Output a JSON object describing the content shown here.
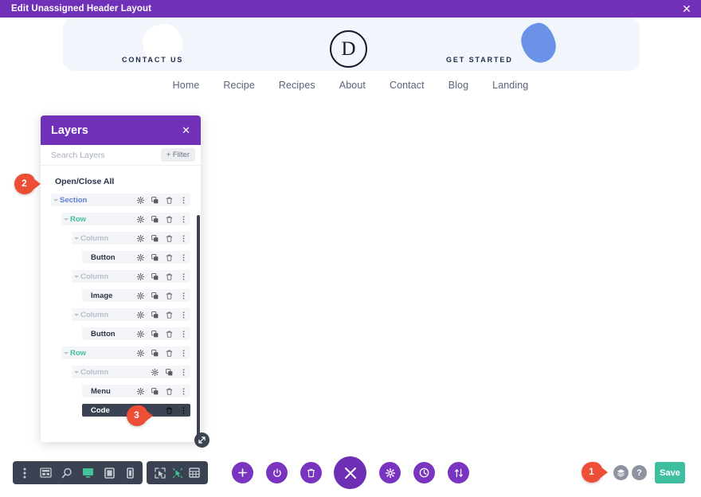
{
  "window": {
    "title": "Edit Unassigned Header Layout",
    "close_icon": "close-icon",
    "accent": "#7030b8"
  },
  "hero": {
    "contact_label": "CONTACT US",
    "started_label": "GET STARTED",
    "logo_letter": "D",
    "background": "#f2f5fc",
    "blob_blue": "#6a93e8"
  },
  "nav": {
    "items": [
      {
        "label": "Home"
      },
      {
        "label": "Recipe"
      },
      {
        "label": "Recipes"
      },
      {
        "label": "About"
      },
      {
        "label": "Contact"
      },
      {
        "label": "Blog"
      },
      {
        "label": "Landing"
      }
    ]
  },
  "layers_panel": {
    "title": "Layers",
    "close_icon": "close-icon",
    "search_placeholder": "Search Layers",
    "search_value": "",
    "filter_label": "+ Filter",
    "open_close_all": "Open/Close All",
    "rows": [
      {
        "label": "Section",
        "type": "section",
        "indent": 0,
        "caret": true,
        "icons": [
          "gear",
          "duplicate",
          "trash",
          "more"
        ],
        "active": false
      },
      {
        "label": "Row",
        "type": "row",
        "indent": 1,
        "caret": true,
        "icons": [
          "gear",
          "duplicate",
          "trash",
          "more"
        ],
        "active": false
      },
      {
        "label": "Column",
        "type": "column",
        "indent": 2,
        "caret": true,
        "icons": [
          "gear",
          "duplicate",
          "trash",
          "more"
        ],
        "active": false
      },
      {
        "label": "Button",
        "type": "module",
        "indent": 3,
        "caret": false,
        "icons": [
          "gear",
          "duplicate",
          "trash",
          "more"
        ],
        "active": false
      },
      {
        "label": "Column",
        "type": "column",
        "indent": 2,
        "caret": true,
        "icons": [
          "gear",
          "duplicate",
          "trash",
          "more"
        ],
        "active": false
      },
      {
        "label": "Image",
        "type": "module",
        "indent": 3,
        "caret": false,
        "icons": [
          "gear",
          "duplicate",
          "trash",
          "more"
        ],
        "active": false
      },
      {
        "label": "Column",
        "type": "column",
        "indent": 2,
        "caret": true,
        "icons": [
          "gear",
          "duplicate",
          "trash",
          "more"
        ],
        "active": false
      },
      {
        "label": "Button",
        "type": "module",
        "indent": 3,
        "caret": false,
        "icons": [
          "gear",
          "duplicate",
          "trash",
          "more"
        ],
        "active": false
      },
      {
        "label": "Row",
        "type": "row",
        "indent": 1,
        "caret": true,
        "icons": [
          "gear",
          "duplicate",
          "trash",
          "more"
        ],
        "active": false
      },
      {
        "label": "Column",
        "type": "column",
        "indent": 2,
        "caret": true,
        "icons": [
          "gear",
          "duplicate",
          "more"
        ],
        "active": false
      },
      {
        "label": "Menu",
        "type": "module",
        "indent": 3,
        "caret": false,
        "icons": [
          "gear",
          "duplicate",
          "trash",
          "more"
        ],
        "active": false
      },
      {
        "label": "Code",
        "type": "module",
        "indent": 3,
        "caret": false,
        "icons": [
          "trash",
          "more"
        ],
        "active": true
      }
    ],
    "colors": {
      "section": "#5b7fd4",
      "row": "#43bfa3",
      "column": "#b7bdc9",
      "module": "#2b3246",
      "active_row": "#3b4252"
    }
  },
  "markers": [
    {
      "id": "1",
      "label": "1"
    },
    {
      "id": "2",
      "label": "2"
    },
    {
      "id": "3",
      "label": "3"
    }
  ],
  "view_toolbar": {
    "icons": [
      {
        "name": "more-vertical-icon",
        "active": false
      },
      {
        "name": "wireframe-icon",
        "active": false
      },
      {
        "name": "zoom-icon",
        "active": false
      },
      {
        "name": "desktop-icon",
        "active": true
      },
      {
        "name": "tablet-icon",
        "active": false
      },
      {
        "name": "phone-icon",
        "active": false
      }
    ]
  },
  "mode_toolbar": {
    "icons": [
      {
        "name": "hover-mode-icon",
        "active": false
      },
      {
        "name": "click-mode-icon",
        "active": true
      },
      {
        "name": "grid-mode-icon",
        "active": false
      }
    ]
  },
  "action_buttons": [
    {
      "name": "add-button",
      "icon": "plus-icon"
    },
    {
      "name": "power-button",
      "icon": "power-icon"
    },
    {
      "name": "trash-button",
      "icon": "trash-icon"
    },
    {
      "name": "close-button",
      "icon": "close-icon"
    },
    {
      "name": "settings-button",
      "icon": "gear-icon"
    },
    {
      "name": "history-button",
      "icon": "clock-icon"
    },
    {
      "name": "sort-button",
      "icon": "sort-icon"
    }
  ],
  "footer_right": {
    "layers_view_icon": "layers-icon",
    "help_label": "?",
    "save_label": "Save",
    "save_color": "#3fbfa0"
  }
}
